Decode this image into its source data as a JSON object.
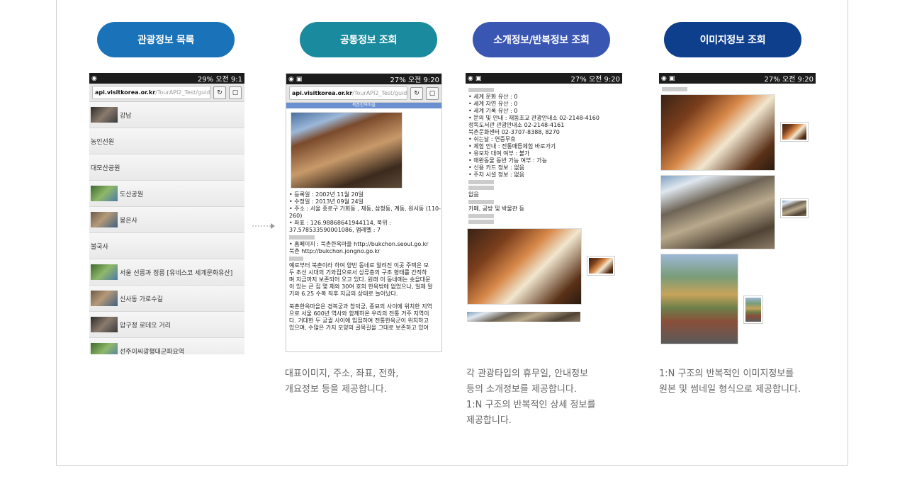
{
  "pills": [
    {
      "label": "관광정보 목록",
      "color": "#1a73b8"
    },
    {
      "label": "공통정보 조회",
      "color": "#1a8a9e"
    },
    {
      "label": "소개정보/반복정보 조회",
      "color": "#3a56b3"
    },
    {
      "label": "이미지정보 조회",
      "color": "#0d3f8c"
    }
  ],
  "phone": {
    "time": "오전 9:20",
    "time_first": "오전 9:1",
    "battery1": "29%",
    "battery": "27%",
    "url_host": "api.visitkorea.or.kr",
    "url_path": "/TourAPI2_Test/guid"
  },
  "list_items": [
    "강남",
    "농인선원",
    "대모산공원",
    "도산공원",
    "봉은사",
    "불국사",
    "서울 선릉과 정릉 [유네스코 세계문화유산]",
    "신사동 가로수길",
    "압구정 로데오 거리",
    "선주이씨광평대군파요역"
  ],
  "common": {
    "header": "북촌한옥마을",
    "lines": [
      "• 등록일 : 2002년 11월 20일",
      "• 수정일 : 2013년 09월 24일",
      "• 주소 : 서울 종로구 가회동 , 재동, 삼청동, 계동, 원서동 (110-",
      "260)",
      "• 좌표 : 126.98868641944114, 북위 :",
      "37.578533590001086, 맵레벨 : 7",
      "• 홈페이지 : 북촌한옥마을 http://bukchon.seoul.go.kr",
      "북촌 http://bukchon.jongno.go.kr"
    ],
    "overview": [
      "예로부터 북촌이라 하여 양반 동네로 알려진 이곳 주택은 모",
      "두 조선 시대의 기와집으로서 상류층의 구조 형태를 간직하",
      "며 지금까지 보존되어 오고 있다. 원래 이 동네에는 솟을대문",
      "이 있는 큰 집 몇 채와 30여 호의 한옥밖에 없었으나, 일제 말",
      "기와 6.25 수복 직후 지금의 상태로 늘어났다.",
      "",
      "북촌한옥마을은 경복궁과 창덕궁, 종묘의 사이에 위치한 지역",
      "으로 서울 600년 역사와 함께하온 우리의 전통 거주 지역이",
      "다. 거대한 두 궁궐 사이에 입접하여 전통한옥군이 위치하고",
      "있으며, 수많은 가지 모양의 골목길을 그대로 보존하고 있어"
    ]
  },
  "intro": {
    "lines": [
      "• 세계 문화 유산 : 0",
      "• 세계 자연 유산 : 0",
      "• 세계 기록 유산 : 0",
      "• 문의 및 안내 : 재동초교 관광안내소 02-2148-4160",
      "정독도서관 관광안내소 02-2148-4161",
      "북촌문화센터 02-3707-8388, 8270",
      "• 쉬는날 : 연중무휴",
      "• 체험 안내 : 전통매듭체험 바로가기",
      "• 유모차 대여 여부 : 불가",
      "• 애완동물 동반 가능 여부 : 가능",
      "• 신용 카드 정보 : 없음",
      "• 주차 시설 정보 : 없음"
    ],
    "extra1": "없음",
    "extra2": "카페, 공방 및 박물관 등"
  },
  "descriptions": [
    [
      "대표이미지, 주소, 좌표, 전화,",
      "개요정보 등을 제공합니다."
    ],
    [
      "각 관광타입의 휴무일, 안내정보",
      "등의 소개정보를 제공합니다.",
      "1:N 구조의 반복적인 상세 정보를",
      "제공합니다."
    ],
    [
      "1:N 구조의 반복적인 이미지정보를",
      "원본 및 썸네일 형식으로 제공합니다."
    ]
  ]
}
